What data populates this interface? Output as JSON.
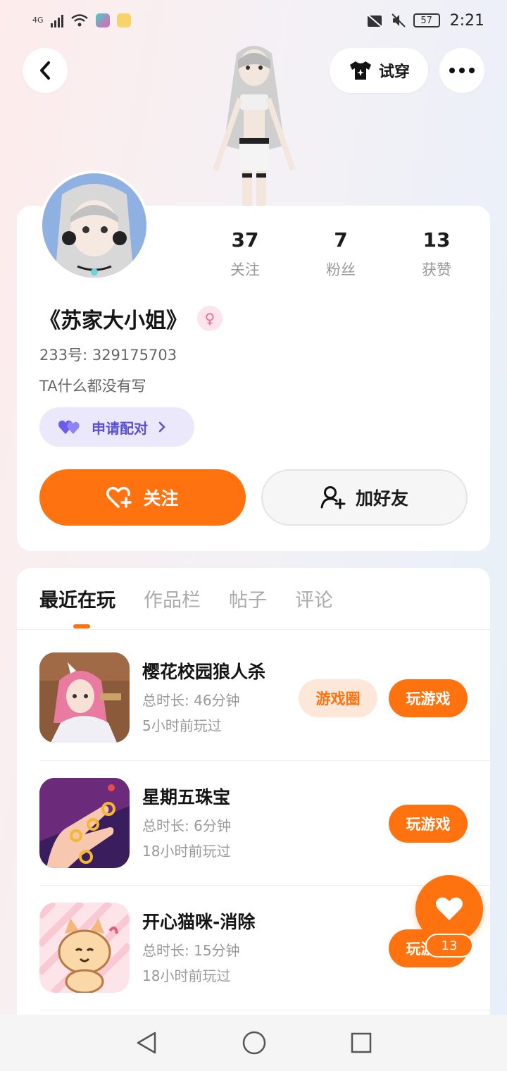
{
  "status_bar": {
    "network": "4G",
    "battery": "57",
    "time": "2:21"
  },
  "header": {
    "try_on_label": "试穿"
  },
  "profile": {
    "stats": [
      {
        "value": "37",
        "label": "关注"
      },
      {
        "value": "7",
        "label": "粉丝"
      },
      {
        "value": "13",
        "label": "获赞"
      }
    ],
    "nickname": "《苏家大小姐》",
    "gender_symbol": "♀",
    "uid": "233号: 329175703",
    "bio": "TA什么都没有写",
    "pair_label": "申请配对",
    "follow_label": "关注",
    "add_friend_label": "加好友"
  },
  "tabs": [
    {
      "label": "最近在玩",
      "active": true
    },
    {
      "label": "作品栏",
      "active": false
    },
    {
      "label": "帖子",
      "active": false
    },
    {
      "label": "评论",
      "active": false
    }
  ],
  "games": [
    {
      "name": "樱花校园狼人杀",
      "duration": "总时长: 46分钟",
      "last_played": "5小时前玩过",
      "circle_label": "游戏圈",
      "play_label": "玩游戏"
    },
    {
      "name": "星期五珠宝",
      "duration": "总时长: 6分钟",
      "last_played": "18小时前玩过",
      "play_label": "玩游戏"
    },
    {
      "name": "开心猫咪-消除",
      "duration": "总时长: 15分钟",
      "last_played": "18小时前玩过",
      "play_label": "玩游戏"
    }
  ],
  "like_fab": {
    "count": "13"
  },
  "colors": {
    "accent": "#ff7210",
    "pair_bg": "#ebe8fb",
    "pair_text": "#5b4fd4"
  }
}
